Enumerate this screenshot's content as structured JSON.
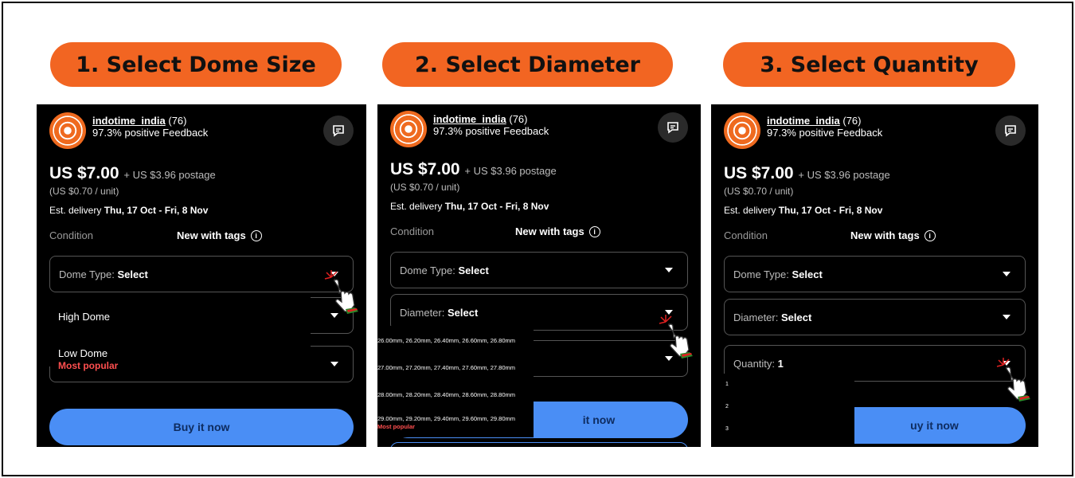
{
  "steps": [
    {
      "label": "1. Select Dome Size"
    },
    {
      "label": "2. Select Diameter"
    },
    {
      "label": "3. Select Quantity"
    }
  ],
  "listing": {
    "seller_name": "indotime_india",
    "seller_count": "(76)",
    "feedback": "97.3% positive Feedback",
    "price": "US $7.00",
    "postage": "+ US $3.96 postage",
    "unit_price": "(US $0.70 / unit)",
    "delivery_label": "Est. delivery",
    "delivery_dates": "Thu, 17 Oct - Fri, 8 Nov",
    "condition_label": "Condition",
    "condition_value": "New with tags",
    "buy_label": "Buy it now",
    "buy_label_partial": "it now",
    "buy_label_partial2": "uy it now"
  },
  "selects": {
    "dome_label": "Dome Type:",
    "dome_value": "Select",
    "diameter_label": "Diameter:",
    "diameter_value": "Select",
    "quantity_label": "Quantity:",
    "quantity_value": "1"
  },
  "dome_options": [
    {
      "label": "High Dome"
    },
    {
      "label": "Low Dome",
      "badge": "Most popular"
    }
  ],
  "diameter_options": [
    {
      "label": "26.00mm, 26.20mm, 26.40mm, 26.60mm, 26.80mm"
    },
    {
      "label": "27.00mm, 27.20mm, 27.40mm, 27.60mm, 27.80mm"
    },
    {
      "label": "28.00mm, 28.20mm, 28.40mm, 28.60mm, 28.80mm"
    },
    {
      "label": "29.00mm, 29.20mm, 29.40mm, 29.60mm, 29.80mm",
      "badge": "Most popular"
    }
  ],
  "quantity_options": [
    "1",
    "2",
    "3"
  ],
  "colors": {
    "accent": "#f26522",
    "buy": "#4a8ef5",
    "popular": "#ff4f4f"
  },
  "icons": [
    "message-icon",
    "info-icon",
    "caret-down-icon",
    "pointer-hand-icon"
  ]
}
